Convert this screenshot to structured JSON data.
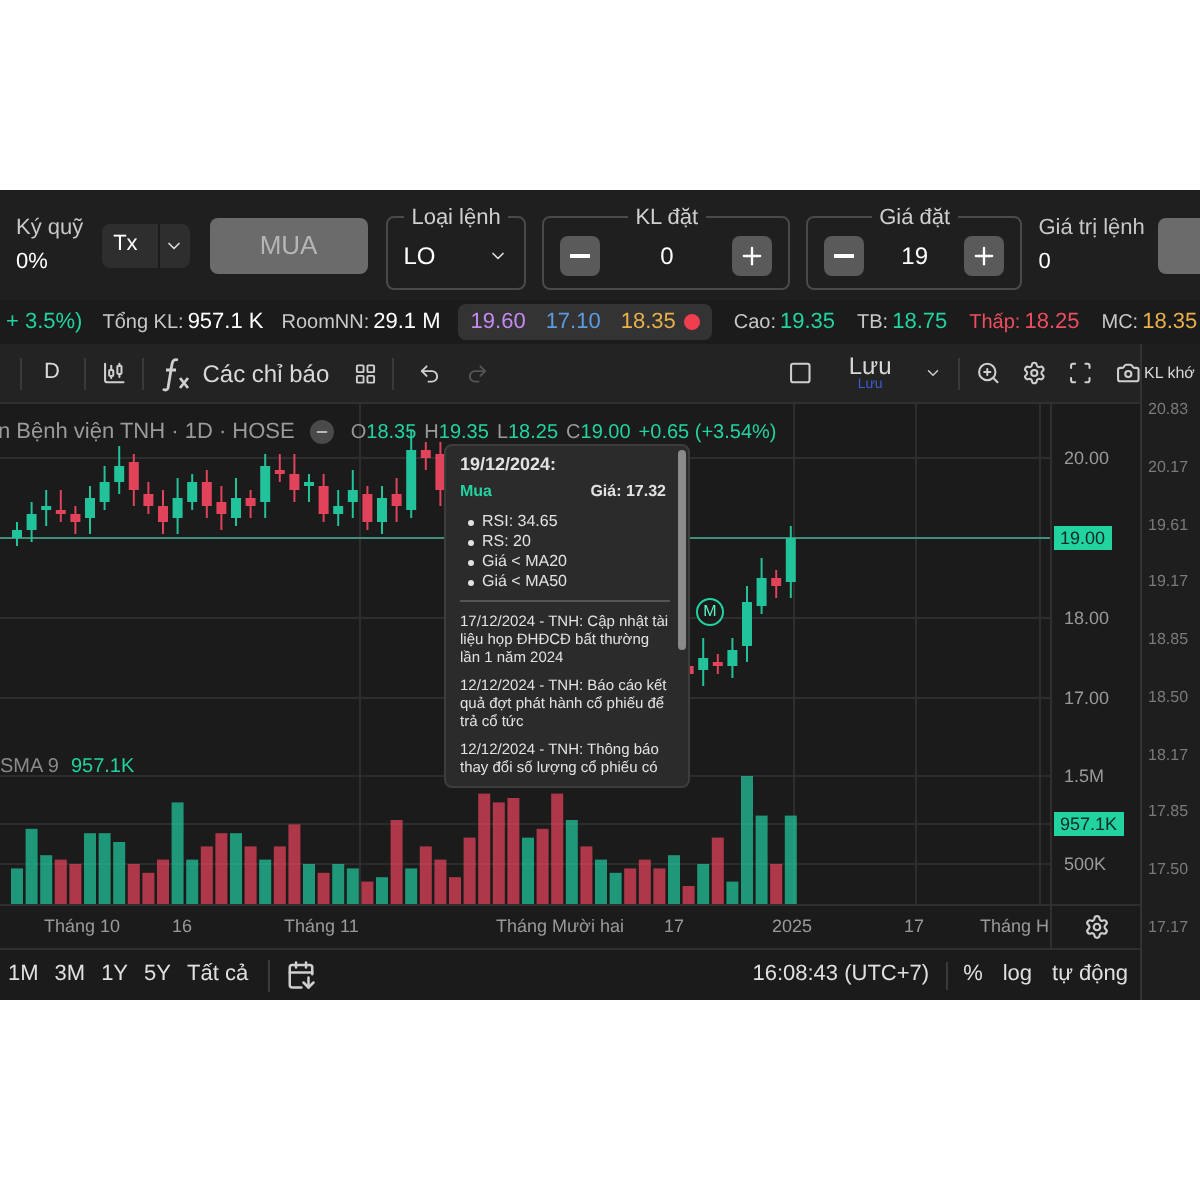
{
  "order_bar": {
    "margin": {
      "label": "Ký quỹ",
      "value": "0%"
    },
    "account": {
      "value": "Tx"
    },
    "buy_button": {
      "label": "MUA",
      "disabled": true
    },
    "order_type": {
      "label": "Loại lệnh",
      "value": "LO"
    },
    "quantity": {
      "label": "KL đặt",
      "value": "0"
    },
    "price": {
      "label": "Giá đặt",
      "value": "19"
    },
    "order_value": {
      "label": "Giá trị lệnh",
      "value": "0"
    }
  },
  "quote_bar": {
    "change": "+ 3.5%)",
    "total_volume": {
      "label": "Tổng KL:",
      "value": "957.1 K"
    },
    "room": {
      "label": "RoomNN:",
      "value": "29.1 M"
    },
    "prices": [
      {
        "value": "19.60",
        "color": "#c58af0"
      },
      {
        "value": "17.10",
        "color": "#5b9be0"
      },
      {
        "value": "18.35",
        "color": "#eab04a"
      }
    ],
    "stats": [
      {
        "label": "Cao:",
        "value": "19.35",
        "color": "#22d3a0",
        "colored_label": false
      },
      {
        "label": "TB:",
        "value": "18.75",
        "color": "#22d3a0",
        "colored_label": false
      },
      {
        "label": "Thấp:",
        "value": "18.25",
        "color": "#ef4d5f",
        "colored_label": true
      },
      {
        "label": "MC:",
        "value": "18.35",
        "color": "#eab04a",
        "colored_label": false
      }
    ]
  },
  "toolbar": {
    "interval": "D",
    "indicators": "Các chỉ báo",
    "save": {
      "label": "Lưu",
      "sublabel": "Lưu"
    }
  },
  "chart": {
    "title": "n Bệnh viện TNH · 1D · HOSE",
    "ohlc": [
      {
        "label": "O",
        "value": "18.35"
      },
      {
        "label": "H",
        "value": "19.35"
      },
      {
        "label": "L",
        "value": "18.25"
      },
      {
        "label": "C",
        "value": "19.00"
      }
    ],
    "change": "+0.65 (+3.54%)",
    "marker": "M",
    "price_axis": [
      "20.00",
      "18.00",
      "17.00"
    ],
    "last_price": "19.00",
    "volume_axis": [
      "1.5M",
      "500K"
    ],
    "last_volume": "957.1K",
    "sma": {
      "label": "SMA 9",
      "value": "957.1K"
    },
    "time_axis": [
      "Tháng 10",
      "16",
      "Tháng 11",
      "Tháng Mười hai",
      "17",
      "2025",
      "17",
      "Tháng H"
    ]
  },
  "tooltip": {
    "date": "19/12/2024:",
    "signal": "Mua",
    "price": "Giá: 17.32",
    "bullets": [
      "RSI: 34.65",
      "RS: 20",
      "Giá < MA20",
      "Giá < MA50"
    ],
    "news": [
      "17/12/2024 - TNH: Cập nhật tài liệu họp ĐHĐCĐ bất thường lần 1 năm 2024",
      "12/12/2024 - TNH: Báo cáo kết quả đợt phát hành cổ phiếu để trả cổ tức",
      "12/12/2024 - TNH: Thông báo thay đổi số lượng cổ phiếu có"
    ]
  },
  "depth_panel": {
    "title": "KL khớ",
    "prices": [
      "20.83",
      "20.17",
      "19.61",
      "19.17",
      "18.85",
      "18.50",
      "18.17",
      "17.85",
      "17.50",
      "17.17"
    ]
  },
  "range_bar": {
    "ranges": [
      "1M",
      "3M",
      "1Y",
      "5Y",
      "Tất cả"
    ],
    "time": "16:08:43 (UTC+7)",
    "options": [
      "%",
      "log",
      "tự động"
    ]
  }
}
